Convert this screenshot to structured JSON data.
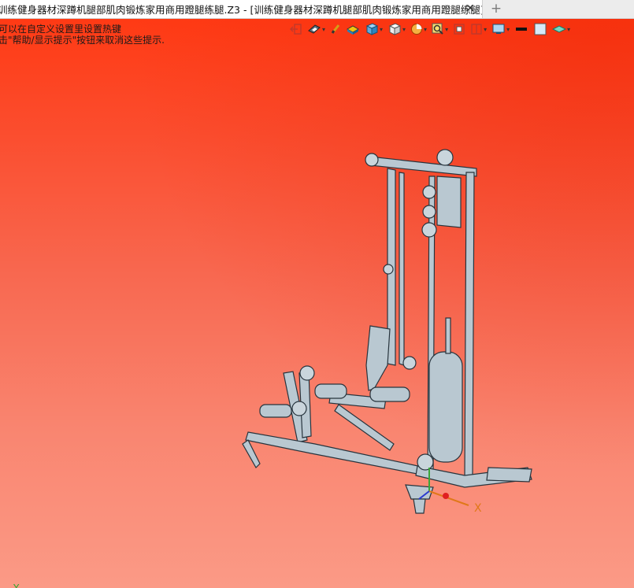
{
  "tab": {
    "title": "训练健身器材深蹲机腿部肌肉锻炼家用商用蹬腿练腿.Z3 - [训练健身器材深蹲机腿部肌肉锻炼家用商用蹬腿练腿]",
    "close_label": "✕",
    "new_tab_label": "+"
  },
  "hints": {
    "line1": "可以在自定义设置里设置热键",
    "line2": "击\"帮助/显示提示\"按钮来取消这些提示."
  },
  "toolbar": {
    "icons": [
      "exit-icon",
      "view-render-icon",
      "pen-icon",
      "shade-icon",
      "cube-blue-icon",
      "cube-white-icon",
      "pie-icon",
      "zoom-icon",
      "fit-icon",
      "section-icon",
      "display-icon",
      "color-black-icon",
      "color-lightblue-icon",
      "layer-icon"
    ]
  },
  "axes": {
    "x_label": "X",
    "y_label": "Y"
  },
  "colors": {
    "bg_top": "#ff3a14",
    "bg_bottom": "#fb9a86",
    "model": "#b7c6cf",
    "model_edge": "#2b3a44"
  }
}
